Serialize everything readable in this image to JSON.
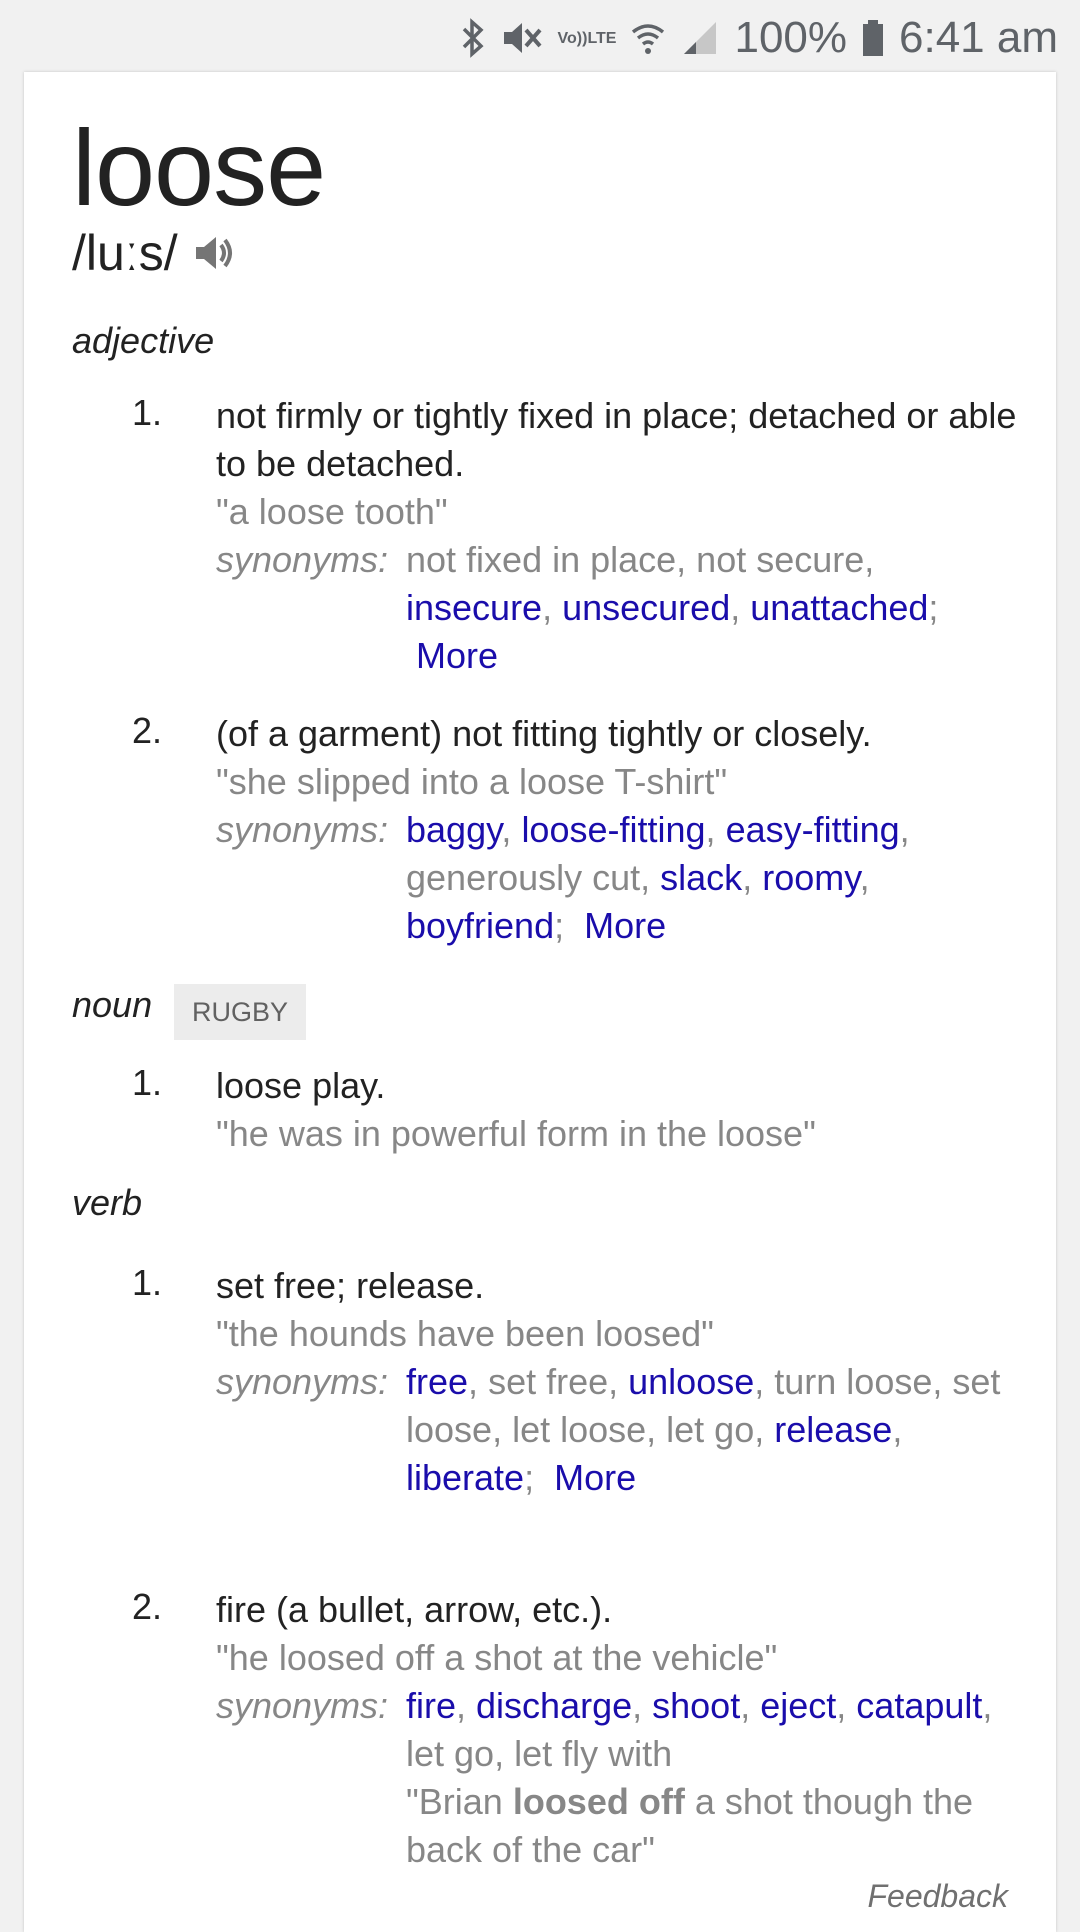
{
  "status": {
    "battery": "100%",
    "time": "6:41 am",
    "volte_top": "Vo))",
    "volte_bottom": "LTE"
  },
  "entry": {
    "word": "loose",
    "phonetic": "/luːs/"
  },
  "adjective": {
    "label": "adjective",
    "senses": [
      {
        "num": "1.",
        "gloss": "not firmly or tightly fixed in place; detached or able to be detached.",
        "example": "\"a loose tooth\"",
        "syn_label": "synonyms:",
        "syn_plain_1": "not fixed in place, not secure,",
        "syn_1": "insecure",
        "syn_2": "unsecured",
        "syn_3": "unattached",
        "more": "More"
      },
      {
        "num": "2.",
        "gloss": "(of a garment) not fitting tightly or closely.",
        "example": "\"she slipped into a loose T-shirt\"",
        "syn_label": "synonyms:",
        "syn_1": "baggy",
        "syn_2": "loose-fitting",
        "syn_3": "easy-fitting",
        "syn_plain_1": "generously cut",
        "syn_4": "slack",
        "syn_5": "roomy",
        "syn_6": "boyfriend",
        "more": "More"
      }
    ]
  },
  "noun": {
    "label": "noun",
    "tag": "RUGBY",
    "senses": [
      {
        "num": "1.",
        "gloss": "loose play.",
        "example": "\"he was in powerful form in the loose\""
      }
    ]
  },
  "verb": {
    "label": "verb",
    "senses": [
      {
        "num": "1.",
        "gloss": "set free; release.",
        "example": "\"the hounds have been loosed\"",
        "syn_label": "synonyms:",
        "syn_1": "free",
        "syn_plain_1": "set free,",
        "syn_2": "unloose",
        "syn_plain_2": "turn loose, set loose, let loose, let go,",
        "syn_3": "release",
        "syn_4": "liberate",
        "more": "More"
      },
      {
        "num": "2.",
        "gloss": "fire (a bullet, arrow, etc.).",
        "example": "\"he loosed off a shot at the vehicle\"",
        "syn_label": "synonyms:",
        "syn_1": "fire",
        "syn_2": "discharge",
        "syn_3": "shoot",
        "syn_4": "eject",
        "syn_5": "catapult",
        "syn_plain_1": "let go, let fly with",
        "quote_pre": "\"Brian ",
        "quote_bold": "loosed off",
        "quote_post": " a shot though the back of the car\""
      }
    ]
  },
  "feedback": "Feedback"
}
